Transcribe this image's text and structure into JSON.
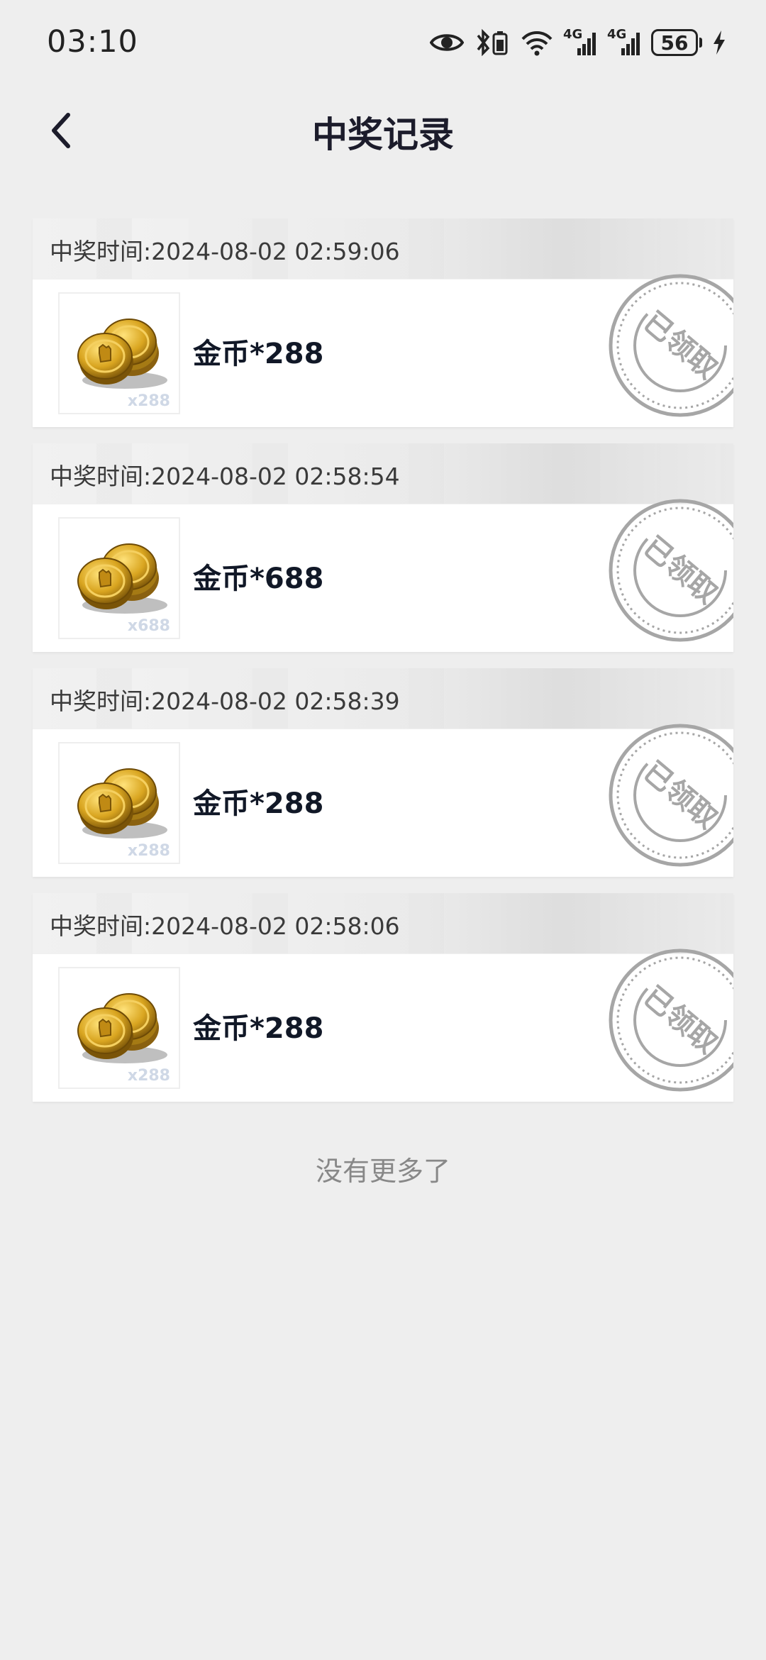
{
  "status_bar": {
    "time": "03:10",
    "network_1": "4G",
    "network_2": "4G",
    "battery_level": "56"
  },
  "header": {
    "title": "中奖记录",
    "back_icon": "chevron-left-icon"
  },
  "records": [
    {
      "time_label": "中奖时间:2024-08-02 02:59:06",
      "prize": "金币*288",
      "thumb_qty": "x288",
      "stamp": "已领取"
    },
    {
      "time_label": "中奖时间:2024-08-02 02:58:54",
      "prize": "金币*688",
      "thumb_qty": "x688",
      "stamp": "已领取"
    },
    {
      "time_label": "中奖时间:2024-08-02 02:58:39",
      "prize": "金币*288",
      "thumb_qty": "x288",
      "stamp": "已领取"
    },
    {
      "time_label": "中奖时间:2024-08-02 02:58:06",
      "prize": "金币*288",
      "thumb_qty": "x288",
      "stamp": "已领取"
    }
  ],
  "footer": {
    "end_text": "没有更多了"
  },
  "colors": {
    "background": "#eeeeee",
    "card": "#ffffff",
    "coin_gold": "#d9a520",
    "stamp_gray": "#a6a6a6"
  }
}
